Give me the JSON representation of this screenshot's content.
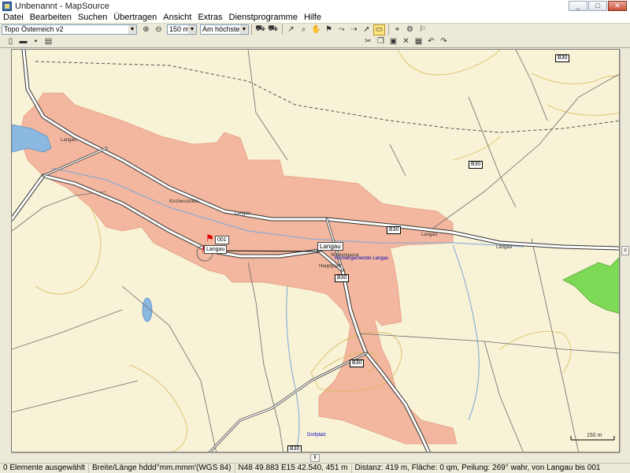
{
  "window": {
    "title": "Unbenannt - MapSource",
    "buttons": [
      "_",
      "□",
      "✕"
    ]
  },
  "menu": [
    "Datei",
    "Bearbeiten",
    "Suchen",
    "Übertragen",
    "Ansicht",
    "Extras",
    "Dienstprogramme",
    "Hilfe"
  ],
  "toolbar": {
    "map_product": "Topo Österreich v2",
    "zoom_level": "150 m",
    "detail": "Am höchsten"
  },
  "map": {
    "labels": {
      "road_b30": "B30",
      "langau": "Langau",
      "langau_road": "Langau",
      "waypoint_001": "001",
      "waypoint_langau": "Langau",
      "street_ha": "Hauptplatz",
      "street_wiese": "Wiesengasse",
      "street_kirche": "Kirchenstraße",
      "poi_blue": "Kirchengemeinde Langau",
      "poi_bottom": "Dorfplatz",
      "scale": "150 m"
    }
  },
  "status": {
    "selection": "0 Elemente ausgewählt",
    "format": "Breite/Länge hddd°mm.mmm'(WGS 84)",
    "position": "N48 49.883 E15 42.540, 451 m",
    "measure": "Distanz: 419 m, Fläche: 0 qm, Peilung: 269° wahr, von Langau bis 001"
  }
}
